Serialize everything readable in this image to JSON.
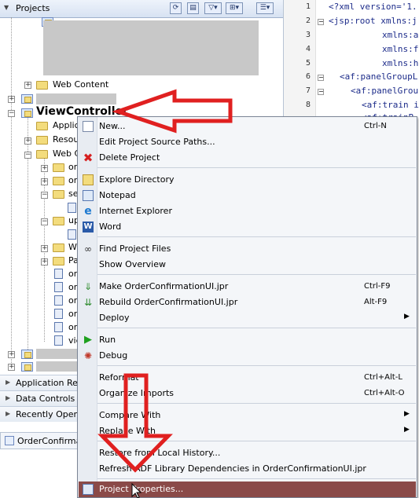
{
  "projects_panel": {
    "title": "Projects",
    "tree": {
      "web_content_label": "Web Content",
      "view_controller_label": "ViewController",
      "applica_label": "Applica",
      "resour_label": "Resour",
      "web_c_label": "Web C",
      "children": [
        "or",
        "or",
        "se",
        "up",
        "Wi",
        "Pa",
        "or",
        "or",
        "or",
        "or",
        "or",
        "vie"
      ]
    }
  },
  "collapsed_panels": [
    "Application Reso",
    "Data Controls",
    "Recently Opened"
  ],
  "bottom_tab": {
    "label": "OrderConfirmat"
  },
  "editor": {
    "line_numbers": [
      "1",
      "2",
      "3",
      "4",
      "5",
      "6",
      "7",
      "8"
    ],
    "lines": [
      "<?xml version='1.",
      "<jsp:root xmlns:j",
      "xmlns:a",
      "xmlns:f",
      "xmlns:h",
      "<af:panelGroupL",
      "<af:panelGrou",
      "<af:train i",
      "<af:trainB"
    ]
  },
  "context_menu": {
    "new": "New...",
    "new_accel": "Ctrl-N",
    "edit_source_paths": "Edit Project Source Paths...",
    "delete_project": "Delete Project",
    "explore_directory": "Explore Directory",
    "notepad": "Notepad",
    "internet_explorer": "Internet Explorer",
    "word": "Word",
    "find_project_files": "Find Project Files",
    "show_overview": "Show Overview",
    "make": "Make OrderConfirmationUI.jpr",
    "make_accel": "Ctrl-F9",
    "rebuild": "Rebuild OrderConfirmationUI.jpr",
    "rebuild_accel": "Alt-F9",
    "deploy": "Deploy",
    "run": "Run",
    "debug": "Debug",
    "reformat": "Reformat",
    "reformat_accel": "Ctrl+Alt-L",
    "organize_imports": "Organize Imports",
    "organize_imports_accel": "Ctrl+Alt-O",
    "compare_with": "Compare With",
    "replace_with": "Replace With",
    "restore_local_history": "Restore from Local History...",
    "refresh_adf": "Refresh ADF Library Dependencies in OrderConfirmationUI.jpr",
    "project_properties": "Project Properties...",
    "submenu_arrow": "▶"
  },
  "colors": {
    "highlight": "#8a4a48",
    "annotation_arrow": "#e02020"
  }
}
